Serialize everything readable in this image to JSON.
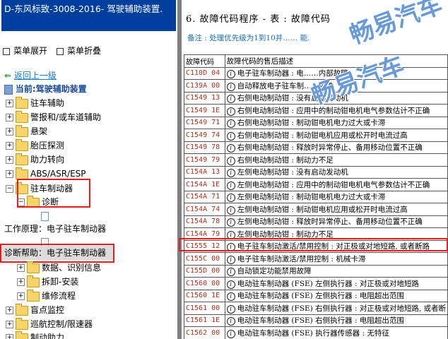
{
  "window_title": "D-东风标致-3008-2016- 驾驶辅助装置.",
  "toolbar": {
    "expand": "菜单展开",
    "collapse": "菜单折叠"
  },
  "nav": {
    "back": "返回上一级",
    "current": "当前:驾驶辅助装置"
  },
  "tree": {
    "items": [
      {
        "label": "驻车辅助"
      },
      {
        "label": "警报和/或车道辅助"
      },
      {
        "label": "悬架"
      },
      {
        "label": "胎压探测"
      },
      {
        "label": "助力转向"
      },
      {
        "label": "ABS/ASR/ESP"
      },
      {
        "label": "驻车制动器"
      },
      {
        "label": "诊断"
      },
      {
        "label": "工作原理：电子驻车制动器"
      },
      {
        "label": "诊断帮助：电子驻车制动器"
      },
      {
        "label": "数据、识别信息"
      },
      {
        "label": "拆卸-安装"
      },
      {
        "label": "维修流程"
      },
      {
        "label": "盲点监控"
      },
      {
        "label": "巡航控制/限速器"
      },
      {
        "label": "制动助力"
      }
    ]
  },
  "document": {
    "heading": "6. 故障代码程序 - 表 : 故障代码",
    "note": "备注 : 处理优先级为1到10并……                      能.",
    "columns": [
      "故障代码",
      "故障代码的售后描述"
    ],
    "rows": [
      {
        "code": "C110D 04",
        "desc": "电子驻车制动器 : 电……内部故障"
      },
      {
        "code": "C139A 00",
        "desc": "自动释放电子驻车制……致性"
      },
      {
        "code": "C1549 13",
        "desc": "右侧电动制动钳 : 没有启动发动机"
      },
      {
        "code": "C1549 1E",
        "desc": "右侧电动制动钳 : 应用中的制动钳电机电气参数估计不正确"
      },
      {
        "code": "C1549 71",
        "desc": "右侧电动制动钳 : 制动钳电机电力过大或卡滞"
      },
      {
        "code": "C1549 74",
        "desc": "右侧电动制动钳 : 制动钳电机应用或松开时电流过高"
      },
      {
        "code": "C1549 78",
        "desc": "右侧电动制动钳 : 释放时异常停止、备用移动位置不正确"
      },
      {
        "code": "C1549 79",
        "desc": "右侧电动制动钳 : 制动力不足"
      },
      {
        "code": "C154A 13",
        "desc": "左侧电动制动钳 : 没有启动发动机"
      },
      {
        "code": "C154A 1E",
        "desc": "左侧电动制动钳 : 应用中的制动钳电机电气参数估计不正确"
      },
      {
        "code": "C154A 71",
        "desc": "左侧电动制动钳 : 制动钳电机电力过大或卡滞"
      },
      {
        "code": "C154A 74",
        "desc": "左侧电动制动钳 : 制动钳电机应用或松开时电流过高"
      },
      {
        "code": "C154A 78",
        "desc": "左侧电动制动钳 : 释放时异常停止、备用移动位置不正确"
      },
      {
        "code": "C154A 79",
        "desc": "左侧电动制动钳 : 制动力不足"
      },
      {
        "code": "C1555 12",
        "desc": "电子驻车制动激活/禁用控制 : 对正极或对地短路, 或者断路"
      },
      {
        "code": "C155C 00",
        "desc": "电子驻车制动激活/禁用控制 : 机械卡滞"
      },
      {
        "code": "C155D 00",
        "desc": "自动锁定功能禁用故障"
      },
      {
        "code": "C1560 00",
        "desc": "电动驻车制动器 (FSE) 左侧执行器 : 对正极或对地短路"
      },
      {
        "code": "C1560 1E",
        "desc": "电动驻车制动器 (FSE) 左侧执行器 : 电阻超出范围"
      },
      {
        "code": "C1561 00",
        "desc": "电动驻车制动器 (FSE) 右侧执行器 : 对正极或对地短路, 或者断"
      },
      {
        "code": "C1561 1E",
        "desc": "电动驻车制动器 (FSE) 右侧执行器 : 电阻超出范围"
      },
      {
        "code": "C1562 00",
        "desc": "电动驻车制动器 (FSE) 执行器传感器 : 无特征"
      }
    ]
  },
  "watermark": {
    "line1": "畅易汽车",
    "line2": "畅易汽车"
  }
}
